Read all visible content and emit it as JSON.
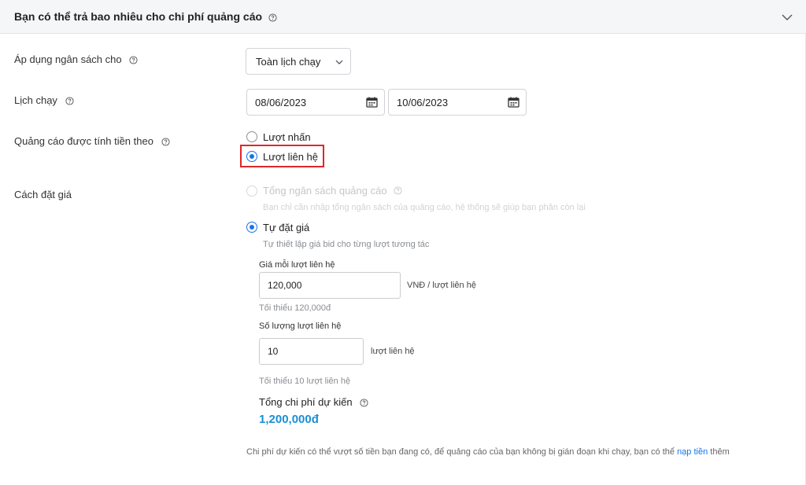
{
  "section": {
    "title": "Bạn có thể trả bao nhiêu cho chi phí quảng cáo"
  },
  "budget_apply": {
    "label": "Áp dụng ngân sách cho",
    "selected": "Toàn lịch chạy"
  },
  "schedule": {
    "label": "Lịch chạy",
    "start_date": "08/06/2023",
    "end_date": "10/06/2023"
  },
  "billing": {
    "label": "Quảng cáo được tính tiền theo",
    "options": [
      "Lượt nhấn",
      "Lượt liên hệ"
    ],
    "selected": "Lượt liên hệ"
  },
  "bidding": {
    "label": "Cách đặt giá",
    "option_total": {
      "label": "Tổng ngân sách quảng cáo",
      "hint": "Bạn chỉ cần nhập tổng ngân sách của quảng cáo, hệ thống sẽ giúp bạn phân còn lại",
      "enabled": false
    },
    "option_manual": {
      "label": "Tự đặt giá",
      "hint": "Tự thiết lập giá bid cho từng lượt tương tác",
      "selected": true
    },
    "price_per_contact": {
      "label": "Giá mỗi lượt liên hệ",
      "value": "120,000",
      "unit": "VNĐ / lượt liên hệ",
      "hint": "Tối thiểu 120,000đ"
    },
    "contact_count": {
      "label": "Số lượng lượt liên hệ",
      "value": "10",
      "unit": "lượt liên hệ",
      "hint": "Tối thiểu 10 lượt liên hệ"
    },
    "total": {
      "label": "Tổng chi phí dự kiến",
      "value": "1,200,000đ"
    }
  },
  "footer": {
    "note_prefix": "Chi phí dự kiến có thể vượt số tiền bạn đang có, để quảng cáo của bạn không bị gián đoạn khi chạy, bạn có thể ",
    "link": "nạp tiền",
    "note_suffix": " thêm"
  },
  "colors": {
    "accent": "#1a73e8",
    "total": "#1a8fd6",
    "highlight_box": "#e0262a"
  }
}
